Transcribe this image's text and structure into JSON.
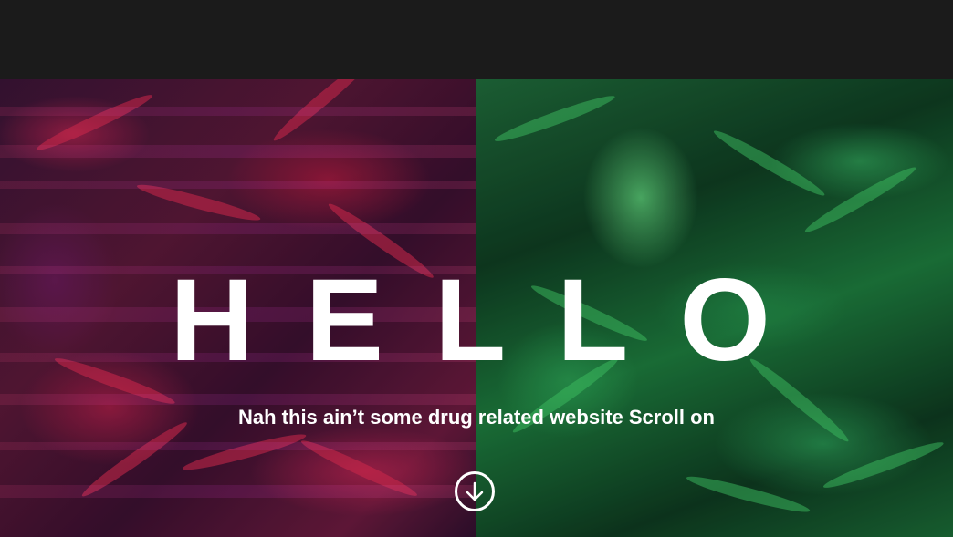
{
  "hero": {
    "heading": "HELLO",
    "tagline": "Nah this ain’t some drug related website Scroll on",
    "scroll_icon": "arrow-down-circle-icon"
  },
  "colors": {
    "topbar": "#1b1b1b",
    "left_panel_tint": "#e0285a",
    "right_panel_tint": "#2ecc71",
    "text": "#ffffff"
  }
}
